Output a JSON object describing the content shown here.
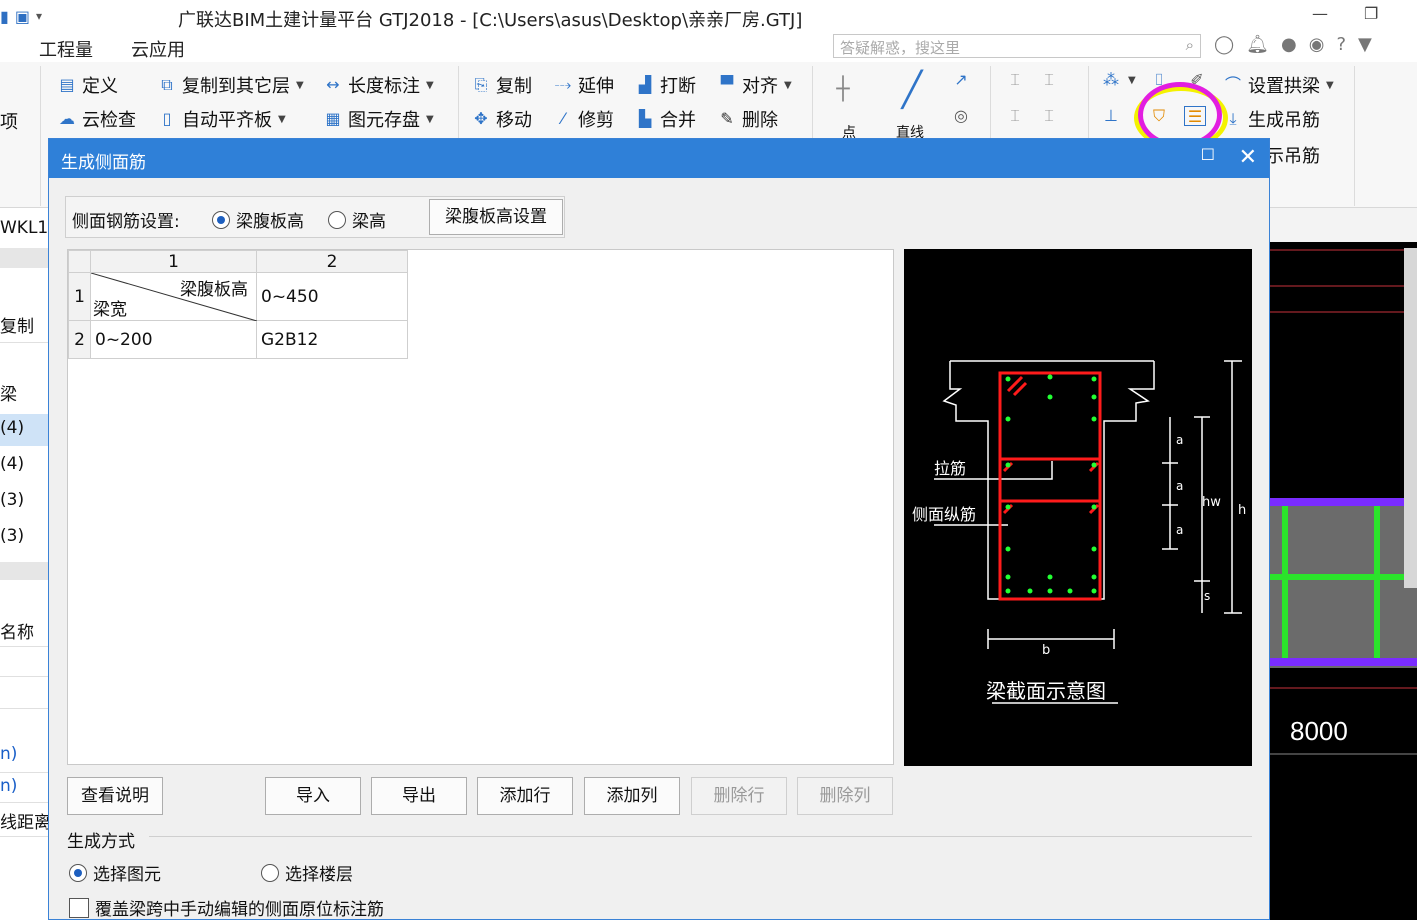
{
  "app": {
    "title": "广联达BIM土建计量平台 GTJ2018 - [C:\\Users\\asus\\Desktop\\亲亲厂房.GTJ]"
  },
  "menu": {
    "items": [
      "工程量",
      "云应用"
    ]
  },
  "search": {
    "placeholder": "答疑解惑，搜这里"
  },
  "ribbon": {
    "left_partial": [
      "项"
    ],
    "buttons": {
      "define": "定义",
      "cloud_check": "云检查",
      "copy_to_layer": "复制到其它层",
      "auto_align_slab": "自动平齐板",
      "length_dim": "长度标注",
      "element_save": "图元存盘",
      "copy": "复制",
      "move": "移动",
      "extend": "延伸",
      "trim": "修剪",
      "break": "打断",
      "merge": "合并",
      "align": "对齐",
      "delete": "删除",
      "point": "点",
      "line": "直线",
      "set_arch_beam": "设置拱梁",
      "gen_hanger": "生成吊筋",
      "show_hanger_partial": "示吊筋"
    }
  },
  "left_panel": {
    "tab_partial": "WKL1(",
    "copy_partial": "复制",
    "items": [
      "梁",
      "(4)",
      "(4)",
      "(3)",
      "(3)"
    ],
    "name_header": "名称",
    "blue_items": [
      "n)",
      "n)"
    ],
    "distance_partial": "线距离"
  },
  "canvas": {
    "dimension": "8000"
  },
  "dialog": {
    "title": "生成侧面筋",
    "side_rebar_setting_label": "侧面钢筋设置:",
    "radio_web_height": "梁腹板高",
    "radio_beam_height": "梁高",
    "web_height_settings_btn": "梁腹板高设置",
    "table": {
      "col_headers": [
        "1",
        "2"
      ],
      "row_numbers": [
        "1",
        "2"
      ],
      "corner_top": "梁腹板高",
      "corner_bottom": "梁宽",
      "header_value": "0~450",
      "row_label": "0~200",
      "cell_value": "G2B12"
    },
    "schematic": {
      "tie_bar": "拉筋",
      "side_long_bar": "侧面纵筋",
      "label_a1": "a",
      "label_a2": "a",
      "label_a3": "a",
      "label_hw": "hw",
      "label_h": "h",
      "label_s": "s",
      "label_b": "b",
      "caption": "梁截面示意图"
    },
    "buttons": {
      "view_desc": "查看说明",
      "import": "导入",
      "export": "导出",
      "add_row": "添加行",
      "add_col": "添加列",
      "del_row": "删除行",
      "del_col": "删除列"
    },
    "gen_mode_label": "生成方式",
    "radio_select_element": "选择图元",
    "radio_select_floor": "选择楼层",
    "overwrite_checkbox": "覆盖梁跨中手动编辑的侧面原位标注筋"
  },
  "colors": {
    "dialog_title_bg": "#2f80d8",
    "highlight_magenta": "#e21ee0",
    "highlight_yellow": "#f4f200",
    "rebar_red": "#ff1b1b",
    "rebar_green": "#22ff33"
  }
}
